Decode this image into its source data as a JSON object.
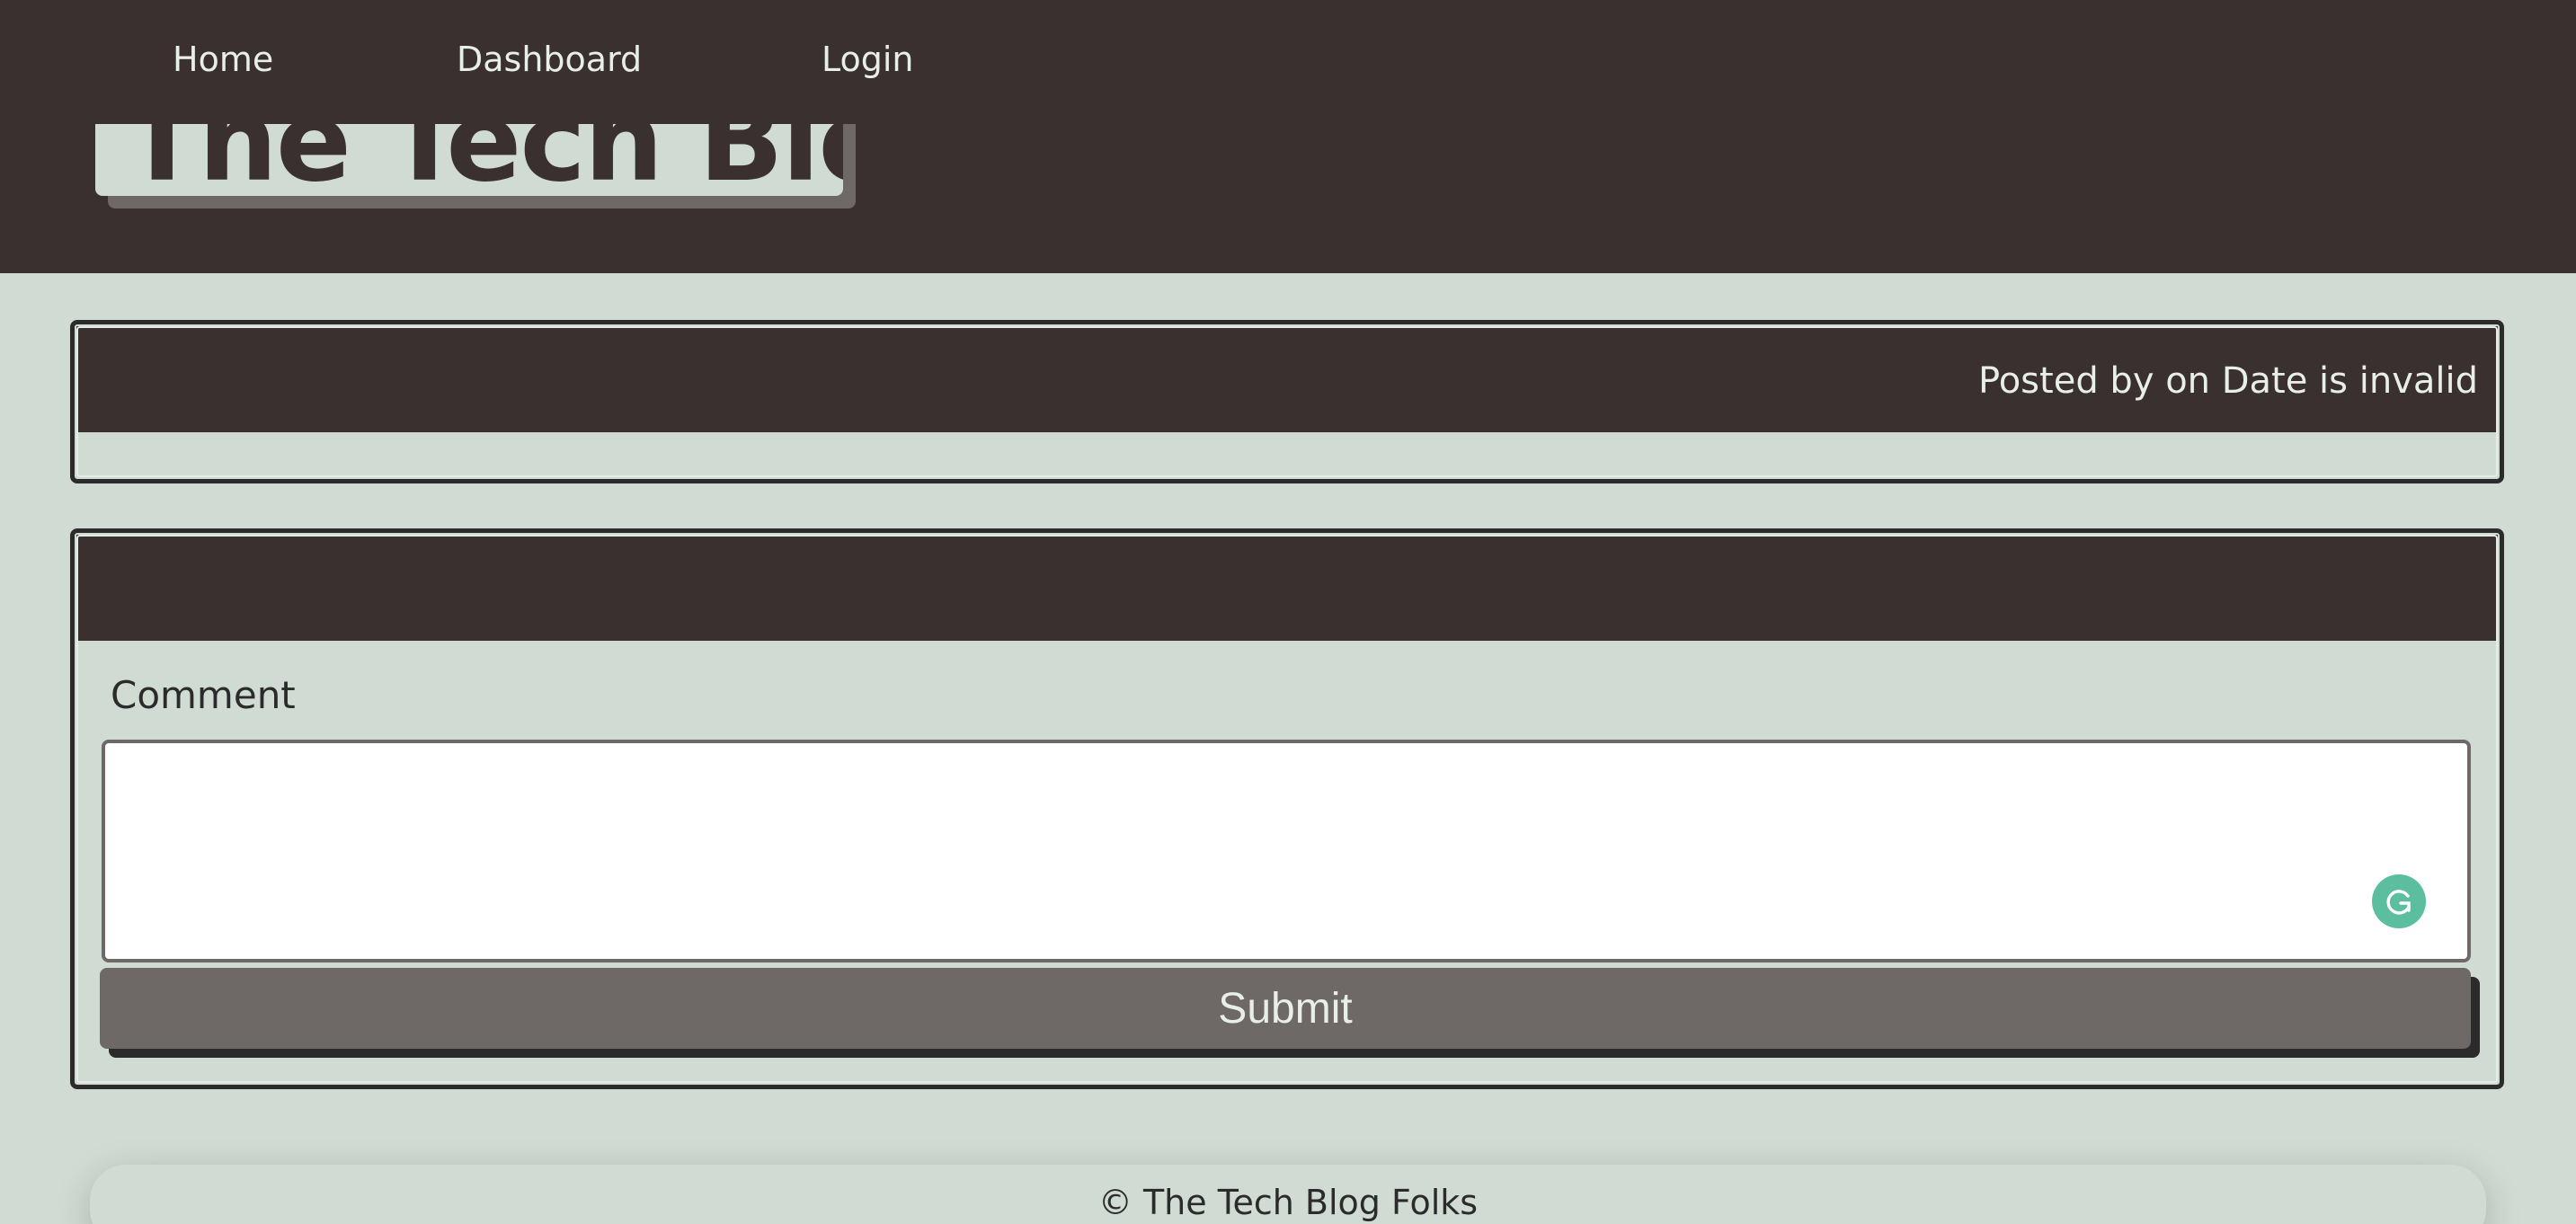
{
  "nav": {
    "items": [
      {
        "label": "Home"
      },
      {
        "label": "Dashboard"
      },
      {
        "label": "Login"
      }
    ]
  },
  "header": {
    "site_title": "The Tech Blog"
  },
  "post": {
    "title": "",
    "meta": "Posted by on Date is invalid",
    "body": ""
  },
  "comment_form": {
    "label": "Comment",
    "value": "",
    "placeholder": "",
    "submit_label": "Submit",
    "grammarly_icon": "grammarly-icon"
  },
  "footer": {
    "text": "© The Tech Blog Folks"
  },
  "colors": {
    "background": "#d0dbd4",
    "header": "#3a3030",
    "button": "#6e6866",
    "grammarly": "#5bbf9f"
  }
}
